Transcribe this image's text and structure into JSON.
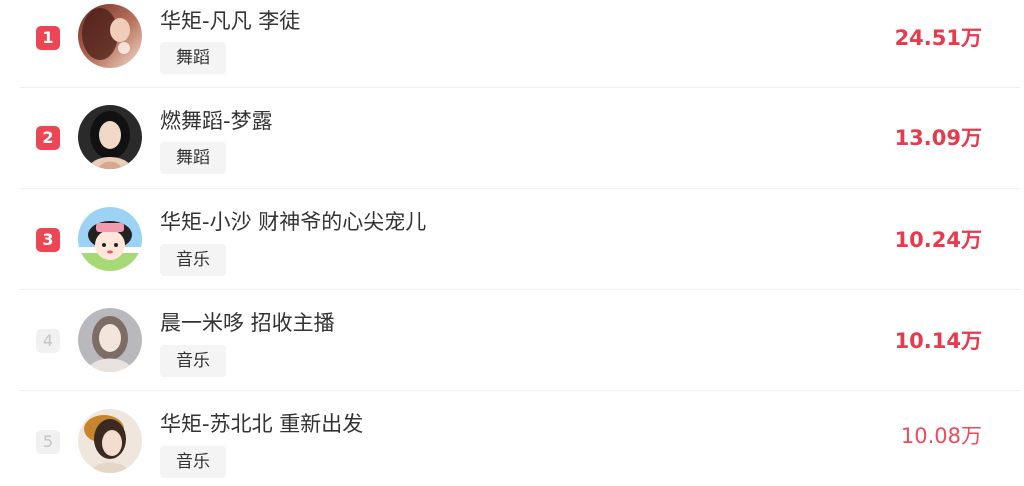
{
  "ranking": {
    "items": [
      {
        "rank": "1",
        "name": "华矩-凡凡 李徒",
        "tag": "舞蹈",
        "value": "24.51万",
        "avatar_icon": "dancer-avatar-icon"
      },
      {
        "rank": "2",
        "name": "燃舞蹈-梦露",
        "tag": "舞蹈",
        "value": "13.09万",
        "avatar_icon": "woman-portrait-avatar-icon"
      },
      {
        "rank": "3",
        "name": "华矩-小沙 财神爷的心尖宠儿",
        "tag": "音乐",
        "value": "10.24万",
        "avatar_icon": "cartoon-girl-avatar-icon"
      },
      {
        "rank": "4",
        "name": "晨一米哆 招收主播",
        "tag": "音乐",
        "value": "10.14万",
        "avatar_icon": "woman-portrait-avatar-icon"
      },
      {
        "rank": "5",
        "name": "华矩-苏北北 重新出发",
        "tag": "音乐",
        "value": "10.08万",
        "avatar_icon": "costume-portrait-avatar-icon"
      }
    ]
  },
  "colors": {
    "accent": "#e83a4c",
    "rank_top_bg": "#ec4654",
    "rank_plain_bg": "#f1f1f1",
    "tag_bg": "#f4f4f4"
  }
}
